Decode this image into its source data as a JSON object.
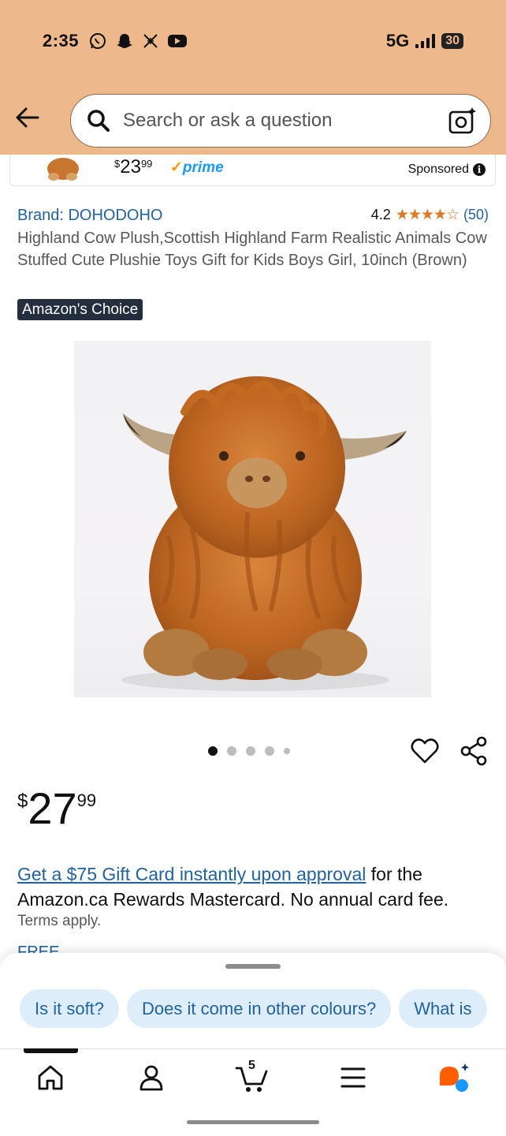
{
  "status_bar": {
    "time": "2:35",
    "network": "5G",
    "battery": "30",
    "notification_icons": [
      "whatsapp-icon",
      "snapchat-icon",
      "x-icon",
      "youtube-icon"
    ]
  },
  "header": {
    "search_placeholder": "Search or ask a question",
    "background_color": "#EDB98A"
  },
  "sponsored": {
    "price_symbol": "$",
    "price_whole": "23",
    "price_fraction": "99",
    "prime_label": "prime",
    "label": "Sponsored"
  },
  "product": {
    "brand": "Brand: DOHODOHO",
    "rating_value": "4.2",
    "rating_stars": "★★★★☆",
    "rating_count": "(50)",
    "title": "Highland Cow Plush,Scottish Highland Farm Realistic Animals Cow Stuffed Cute Plushie Toys Gift for Kids Boys Girl, 10inch (Brown)",
    "badge": "Amazon's Choice",
    "image_count": 5,
    "active_image": 1,
    "price_symbol": "$",
    "price_whole": "27",
    "price_fraction": "99"
  },
  "promo": {
    "link_text": "Get a $75 Gift Card instantly upon approval",
    "body_text": " for the Amazon.ca Rewards Mastercard. No annual card fee.",
    "terms": "Terms apply.",
    "peek_text": "FREE"
  },
  "suggestions": {
    "chips": [
      "Is it soft?",
      "Does it come in other colours?",
      "What is"
    ]
  },
  "bottom_nav": {
    "items": [
      "home-icon",
      "account-icon",
      "cart-icon",
      "menu-icon",
      "rufus-icon"
    ],
    "cart_count": "5",
    "accent_color": "#FF5E00"
  }
}
